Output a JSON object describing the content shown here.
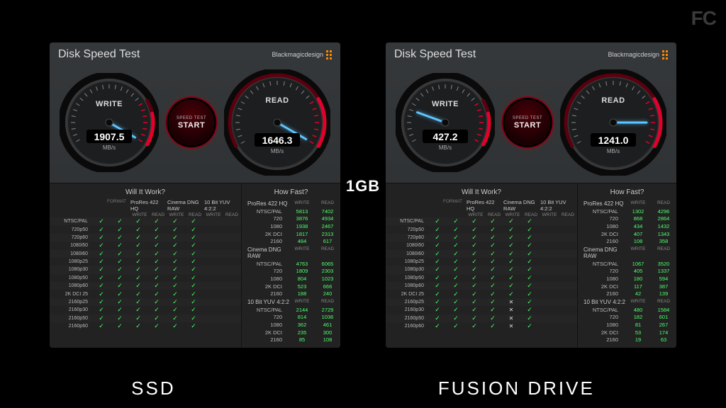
{
  "watermark": "FC",
  "center_label": "1GB",
  "footer": {
    "left": "SSD",
    "right": "FUSION DRIVE"
  },
  "app": {
    "title": "Disk Speed Test",
    "brand": "Blackmagicdesign",
    "start_top": "SPEED TEST",
    "start_bottom": "START",
    "write_label": "WRITE",
    "read_label": "READ",
    "units": "MB/s",
    "will_header": "Will It Work?",
    "howfast_header": "How Fast?",
    "wr": "WRITE",
    "rd": "READ",
    "codec_groups": [
      "ProRes 422 HQ",
      "Cinema DNG RAW",
      "10 Bit YUV 4:2:2"
    ],
    "format_label": "FORMAT",
    "will_rows": [
      "NTSC/PAL",
      "720p50",
      "720p60",
      "1080i50",
      "1080i60",
      "1080p25",
      "1080p30",
      "1080p50",
      "1080p60",
      "2K DCI 25",
      "2160p25",
      "2160p30",
      "2160p50",
      "2160p60"
    ],
    "howfast_groups": [
      {
        "name": "ProRes 422 HQ",
        "rows": [
          "NTSC/PAL",
          "720",
          "1080",
          "2K DCI",
          "2160"
        ]
      },
      {
        "name": "Cinema DNG RAW",
        "rows": [
          "NTSC/PAL",
          "720",
          "1080",
          "2K DCI",
          "2160"
        ]
      },
      {
        "name": "10 Bit YUV 4:2:2",
        "rows": [
          "NTSC/PAL",
          "720",
          "1080",
          "2K DCI",
          "2160"
        ]
      }
    ]
  },
  "left": {
    "label": "SSD",
    "write": "1907.5",
    "read": "1646.3",
    "write_needle_deg": 180,
    "read_needle_deg": 165,
    "will": [
      [
        1,
        1,
        1,
        1,
        1,
        1
      ],
      [
        1,
        1,
        1,
        1,
        1,
        1
      ],
      [
        1,
        1,
        1,
        1,
        1,
        1
      ],
      [
        1,
        1,
        1,
        1,
        1,
        1
      ],
      [
        1,
        1,
        1,
        1,
        1,
        1
      ],
      [
        1,
        1,
        1,
        1,
        1,
        1
      ],
      [
        1,
        1,
        1,
        1,
        1,
        1
      ],
      [
        1,
        1,
        1,
        1,
        1,
        1
      ],
      [
        1,
        1,
        1,
        1,
        1,
        1
      ],
      [
        1,
        1,
        1,
        1,
        1,
        1
      ],
      [
        1,
        1,
        1,
        1,
        1,
        1
      ],
      [
        1,
        1,
        1,
        1,
        1,
        1
      ],
      [
        1,
        1,
        1,
        1,
        1,
        1
      ],
      [
        1,
        1,
        1,
        1,
        1,
        1
      ]
    ],
    "howfast": [
      [
        [
          "5813",
          "7402"
        ],
        [
          "3876",
          "4934"
        ],
        [
          "1938",
          "2467"
        ],
        [
          "1817",
          "2313"
        ],
        [
          "484",
          "617"
        ]
      ],
      [
        [
          "4763",
          "6065"
        ],
        [
          "1809",
          "2303"
        ],
        [
          "804",
          "1023"
        ],
        [
          "523",
          "666"
        ],
        [
          "188",
          "240"
        ]
      ],
      [
        [
          "2144",
          "2729"
        ],
        [
          "814",
          "1036"
        ],
        [
          "362",
          "461"
        ],
        [
          "235",
          "300"
        ],
        [
          "85",
          "108"
        ]
      ]
    ]
  },
  "right": {
    "label": "FUSION DRIVE",
    "write": "427.2",
    "read": "1241.0",
    "write_needle_deg": -40,
    "read_needle_deg": 120,
    "will": [
      [
        1,
        1,
        1,
        1,
        1,
        1
      ],
      [
        1,
        1,
        1,
        1,
        1,
        1
      ],
      [
        1,
        1,
        1,
        1,
        1,
        1
      ],
      [
        1,
        1,
        1,
        1,
        1,
        1
      ],
      [
        1,
        1,
        1,
        1,
        1,
        1
      ],
      [
        1,
        1,
        1,
        1,
        1,
        1
      ],
      [
        1,
        1,
        1,
        1,
        1,
        1
      ],
      [
        1,
        1,
        1,
        1,
        1,
        1
      ],
      [
        1,
        1,
        1,
        1,
        1,
        1
      ],
      [
        1,
        1,
        1,
        1,
        1,
        1
      ],
      [
        1,
        1,
        1,
        1,
        0,
        1
      ],
      [
        1,
        1,
        1,
        1,
        0,
        1
      ],
      [
        1,
        1,
        1,
        1,
        0,
        1
      ],
      [
        1,
        1,
        1,
        1,
        0,
        1
      ]
    ],
    "howfast": [
      [
        [
          "1302",
          "4296"
        ],
        [
          "868",
          "2864"
        ],
        [
          "434",
          "1432"
        ],
        [
          "407",
          "1343"
        ],
        [
          "108",
          "358"
        ]
      ],
      [
        [
          "1067",
          "3520"
        ],
        [
          "405",
          "1337"
        ],
        [
          "180",
          "594"
        ],
        [
          "117",
          "387"
        ],
        [
          "42",
          "139"
        ]
      ],
      [
        [
          "480",
          "1584"
        ],
        [
          "182",
          "601"
        ],
        [
          "81",
          "267"
        ],
        [
          "53",
          "174"
        ],
        [
          "19",
          "63"
        ]
      ]
    ]
  }
}
